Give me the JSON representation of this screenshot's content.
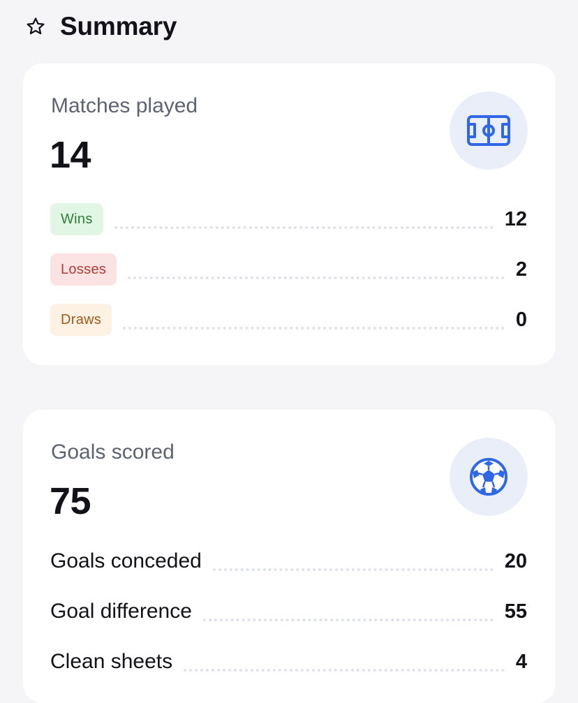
{
  "header": {
    "title": "Summary",
    "icon": "star-icon"
  },
  "matches_card": {
    "label": "Matches played",
    "value": "14",
    "icon": "football-pitch-icon",
    "rows": [
      {
        "label": "Wins",
        "value": "12"
      },
      {
        "label": "Losses",
        "value": "2"
      },
      {
        "label": "Draws",
        "value": "0"
      }
    ]
  },
  "goals_card": {
    "label": "Goals scored",
    "value": "75",
    "icon": "soccer-ball-icon",
    "rows": [
      {
        "label": "Goals conceded",
        "value": "20"
      },
      {
        "label": "Goal difference",
        "value": "55"
      },
      {
        "label": "Clean sheets",
        "value": "4"
      }
    ]
  },
  "colors": {
    "accent": "#2f67e6",
    "win_bg": "#e1f6e4",
    "loss_bg": "#fbe3e3",
    "draw_bg": "#fdf1e3"
  }
}
